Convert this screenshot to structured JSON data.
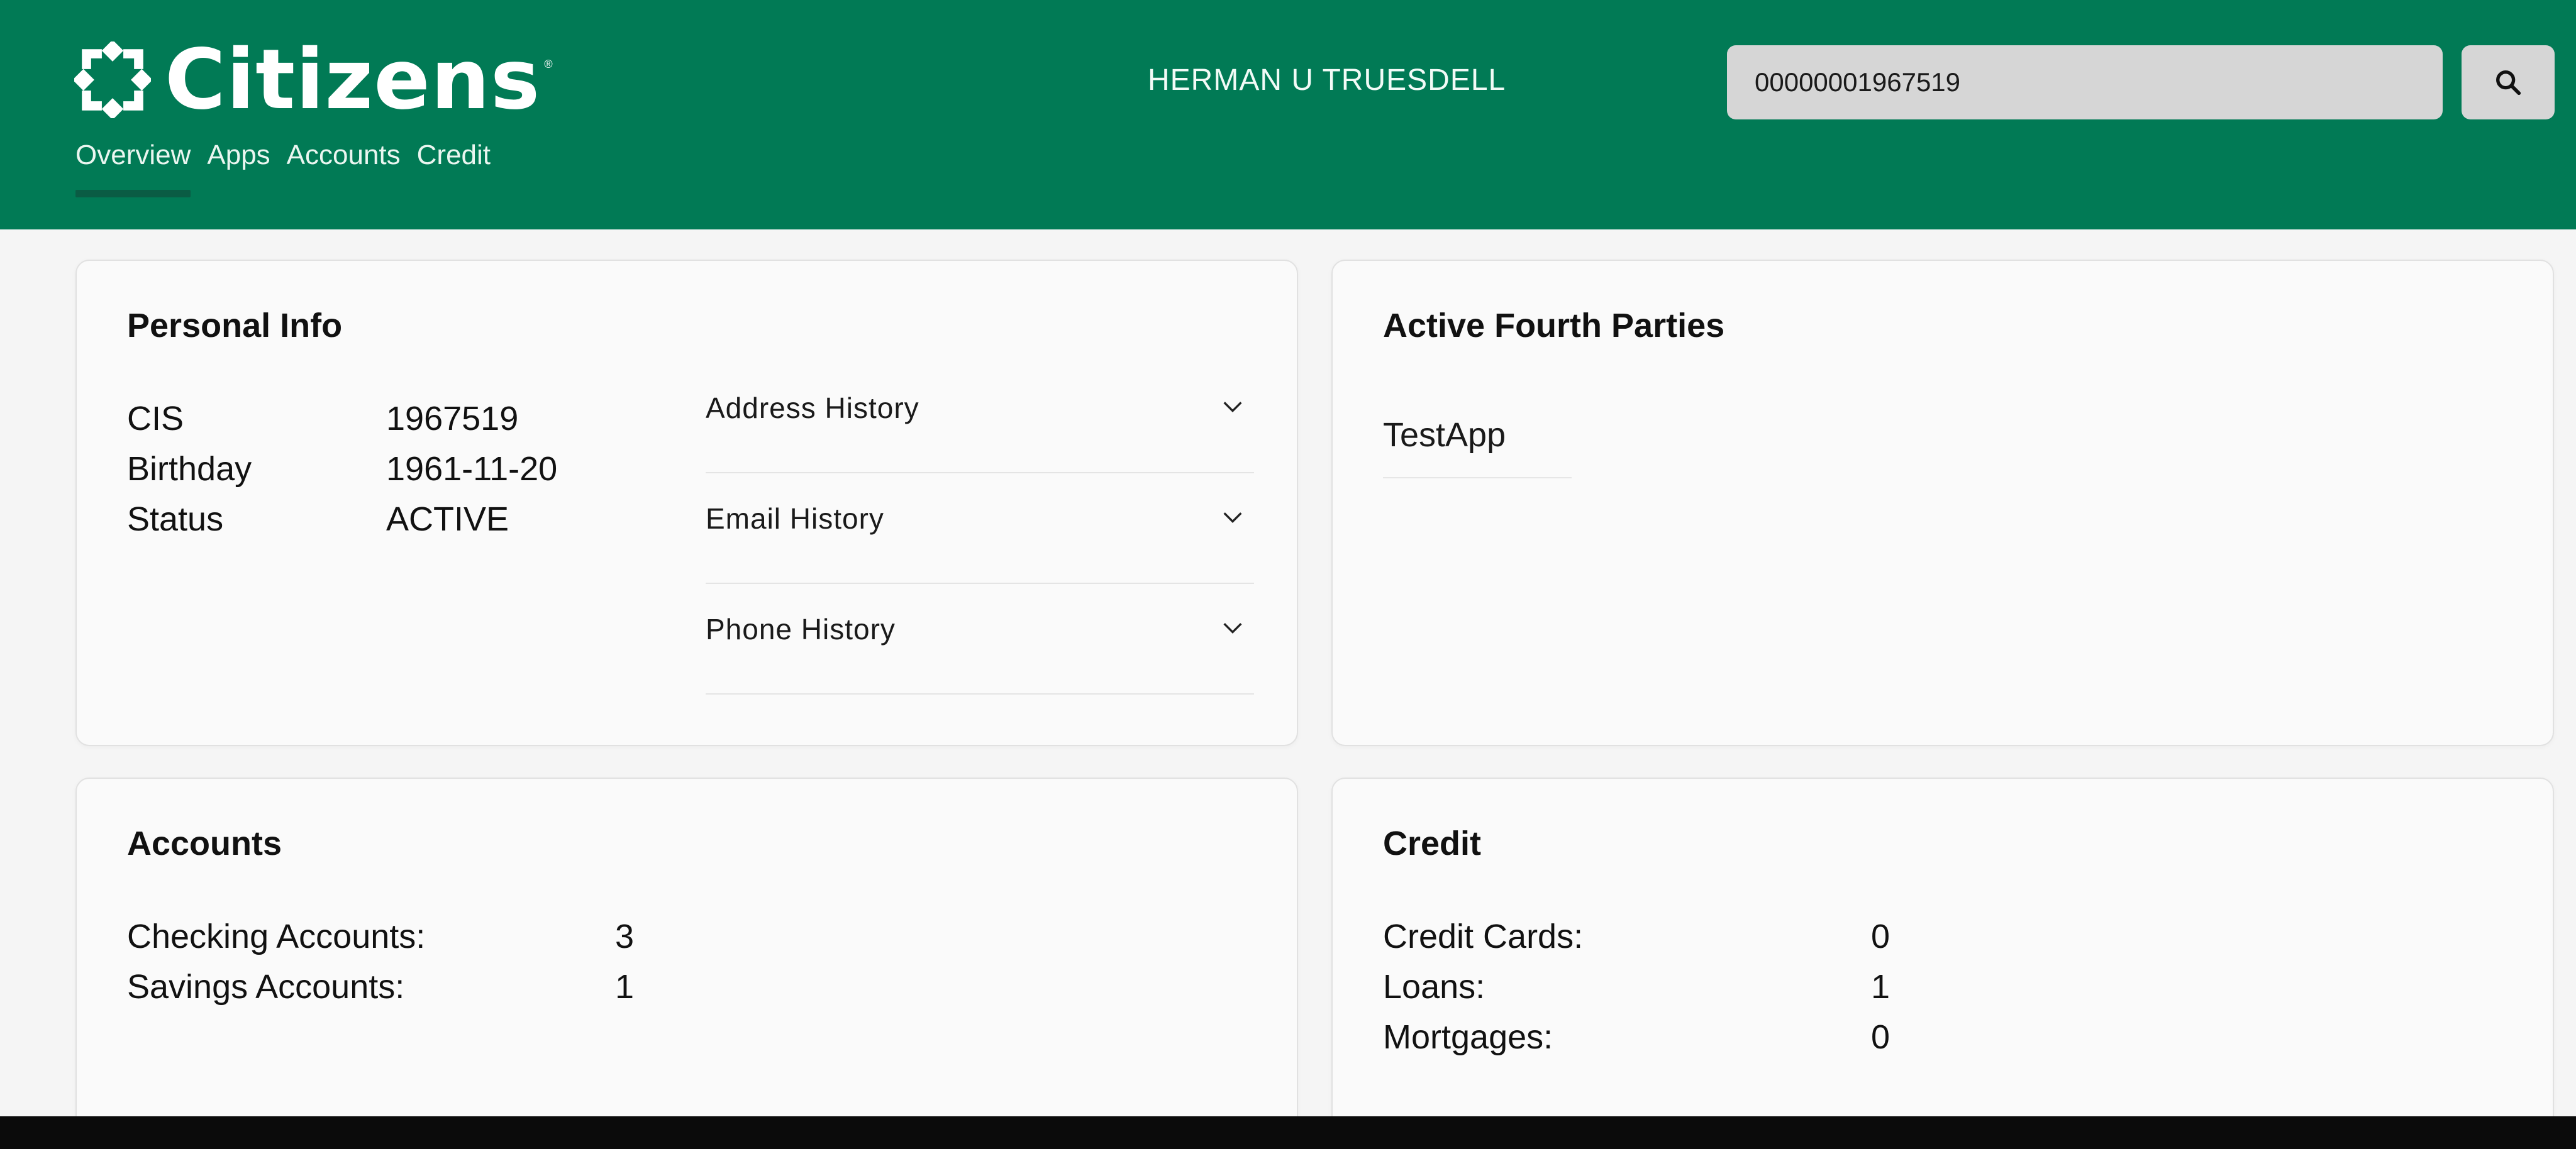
{
  "brand": {
    "name": "Citizens",
    "accent_color": "#017a55",
    "logo_icon": "citizens-logo-mark"
  },
  "nav": {
    "items": [
      {
        "label": "Overview",
        "active": true
      },
      {
        "label": "Apps",
        "active": false
      },
      {
        "label": "Accounts",
        "active": false
      },
      {
        "label": "Credit",
        "active": false
      }
    ]
  },
  "header": {
    "customer_name": "HERMAN U TRUESDELL"
  },
  "search": {
    "value": "00000001967519",
    "button_icon": "search-icon"
  },
  "personal_info": {
    "title": "Personal Info",
    "fields": [
      {
        "label": "CIS",
        "value": "1967519"
      },
      {
        "label": "Birthday",
        "value": "1961-11-20"
      },
      {
        "label": "Status",
        "value": "ACTIVE"
      }
    ],
    "accordions": [
      {
        "label": "Address History",
        "icon": "chevron-down-icon"
      },
      {
        "label": "Email History",
        "icon": "chevron-down-icon"
      },
      {
        "label": "Phone History",
        "icon": "chevron-down-icon"
      }
    ]
  },
  "fourth_parties": {
    "title": "Active Fourth Parties",
    "items": [
      "TestApp"
    ]
  },
  "accounts": {
    "title": "Accounts",
    "rows": [
      {
        "label": "Checking Accounts:",
        "value": "3"
      },
      {
        "label": "Savings Accounts:",
        "value": "1"
      }
    ]
  },
  "credit": {
    "title": "Credit",
    "rows": [
      {
        "label": "Credit Cards:",
        "value": "0"
      },
      {
        "label": "Loans:",
        "value": "1"
      },
      {
        "label": "Mortgages:",
        "value": "0"
      }
    ]
  }
}
